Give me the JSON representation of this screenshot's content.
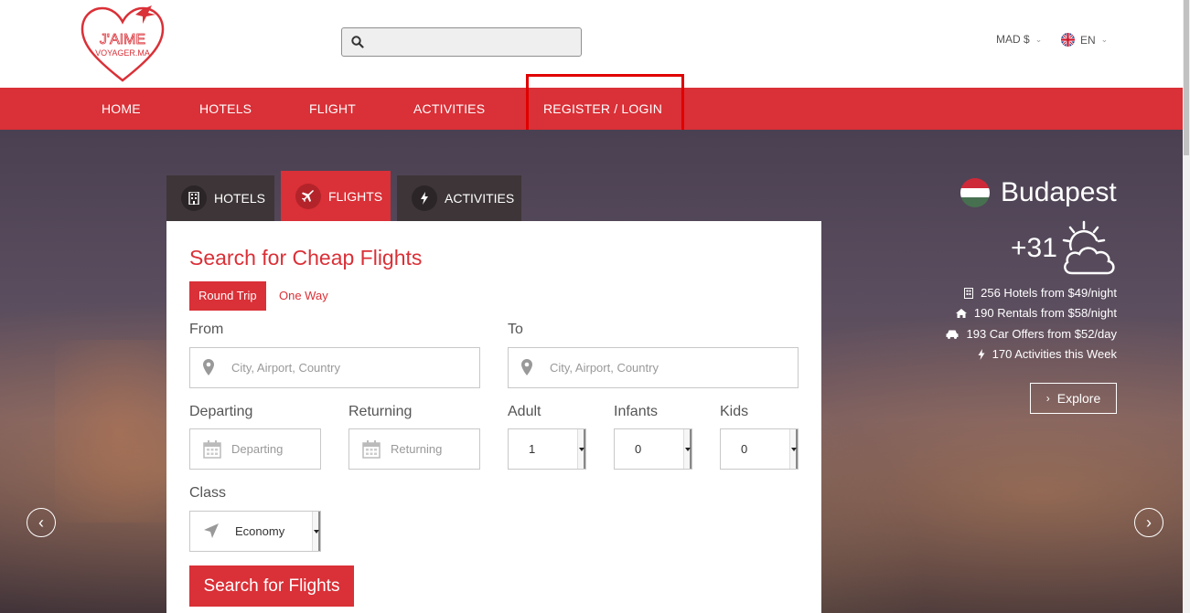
{
  "header": {
    "logo_text_top": "J'AIME",
    "logo_text_bottom": "VOYAGER.MA",
    "search_placeholder": "",
    "currency": "MAD $",
    "language": "EN"
  },
  "nav": {
    "items": [
      "HOME",
      "HOTELS",
      "FLIGHT",
      "ACTIVITIES",
      "REGISTER / LOGIN"
    ]
  },
  "tabs": [
    {
      "label": "HOTELS",
      "icon": "building-icon"
    },
    {
      "label": "FLIGHTS",
      "icon": "plane-icon"
    },
    {
      "label": "ACTIVITIES",
      "icon": "bolt-icon"
    }
  ],
  "search": {
    "title": "Search for Cheap Flights",
    "trip_round": "Round Trip",
    "trip_oneway": "One Way",
    "from_label": "From",
    "from_placeholder": "City, Airport, Country",
    "to_label": "To",
    "to_placeholder": "City, Airport, Country",
    "departing_label": "Departing",
    "departing_placeholder": "Departing",
    "returning_label": "Returning",
    "returning_placeholder": "Returning",
    "adult_label": "Adult",
    "adult_value": "1",
    "infants_label": "Infants",
    "infants_value": "0",
    "kids_label": "Kids",
    "kids_value": "0",
    "class_label": "Class",
    "class_value": "Economy",
    "submit": "Search for Flights"
  },
  "destination": {
    "city": "Budapest",
    "temperature": "+31",
    "stats": [
      "256 Hotels from $49/night",
      "190 Rentals from $58/night",
      "193 Car Offers from $52/day",
      "170 Activities this Week"
    ],
    "explore": "Explore"
  },
  "colors": {
    "brand_red": "#da3037",
    "tab_dark": "#3d3537"
  }
}
